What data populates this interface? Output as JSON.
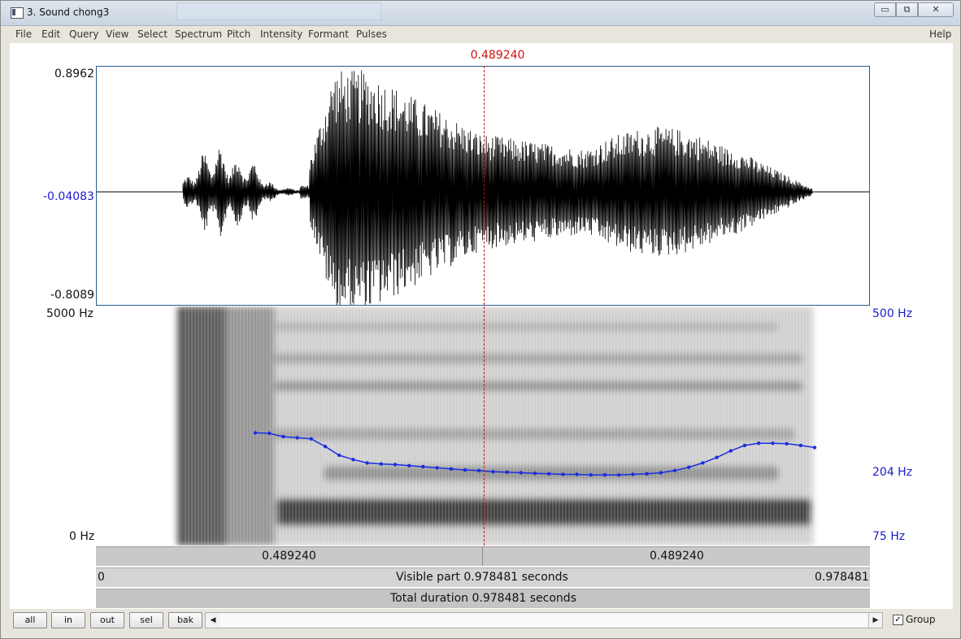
{
  "window": {
    "title": "3. Sound chong3",
    "controls": {
      "minimize": "▭",
      "maximize": "⧉",
      "close": "✕"
    }
  },
  "menu": [
    "File",
    "Edit",
    "Query",
    "View",
    "Select",
    "Spectrum",
    "Pitch",
    "Intensity",
    "Formant",
    "Pulses"
  ],
  "help_label": "Help",
  "cursor": {
    "time": "0.489240"
  },
  "waveform": {
    "max_label": "0.8962",
    "mid_label": "-0.04083",
    "min_label": "-0.8089"
  },
  "spectrogram": {
    "top_freq": "5000 Hz",
    "bottom_freq": "0 Hz"
  },
  "pitch": {
    "top_label": "500 Hz",
    "mid_label": "204 Hz",
    "bottom_label": "75 Hz",
    "color": "#1a2ee0",
    "contour_hz": [
      281,
      280,
      274,
      272,
      270,
      256,
      240,
      232,
      226,
      224,
      223,
      221,
      219,
      217,
      215,
      213,
      212,
      210,
      209,
      208,
      207,
      206,
      205,
      205,
      204,
      204,
      204,
      205,
      206,
      208,
      212,
      218,
      226,
      236,
      248,
      258,
      262,
      262,
      261,
      258,
      254
    ]
  },
  "time_bars": {
    "left_selection": "0.489240",
    "right_selection": "0.489240",
    "visible_start": "0",
    "visible_text": "Visible part 0.978481 seconds",
    "visible_end": "0.978481",
    "total_text": "Total duration 0.978481 seconds"
  },
  "buttons": [
    "all",
    "in",
    "out",
    "sel",
    "bak"
  ],
  "group": {
    "label": "Group",
    "checked": true
  }
}
